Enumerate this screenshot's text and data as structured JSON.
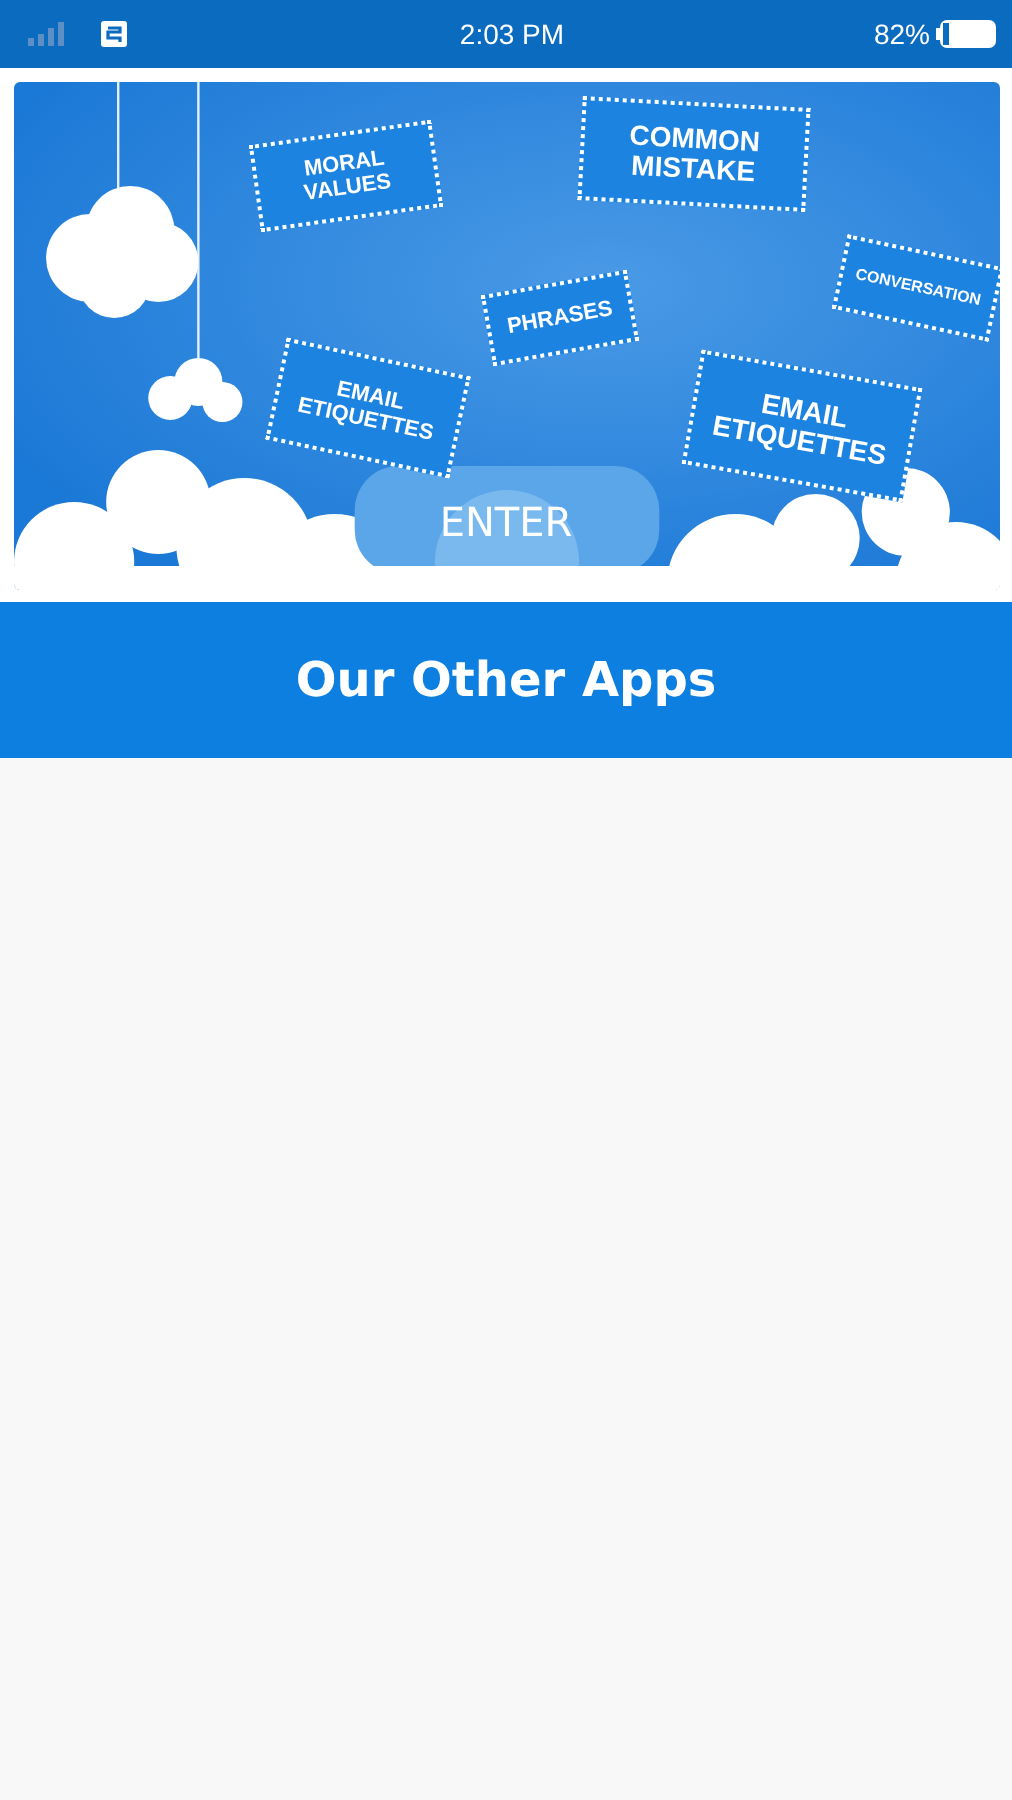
{
  "status_bar": {
    "time": "2:03 PM",
    "battery": "82%"
  },
  "banner": {
    "labels": [
      {
        "text": "MORAL VALUES"
      },
      {
        "text": "COMMON MISTAKE"
      },
      {
        "text": "CONVERSATION"
      },
      {
        "text": "PHRASES"
      },
      {
        "text": "EMAIL ETIQUETTES"
      },
      {
        "text": "EMAIL ETIQUETTES"
      }
    ],
    "button": "ENTER"
  },
  "section_header": {
    "title": "Our Other Apps"
  }
}
